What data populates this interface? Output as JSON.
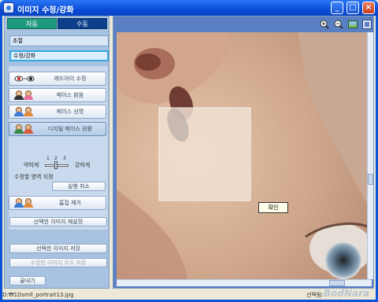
{
  "window": {
    "title": "이미지 수정/강화"
  },
  "tabs": [
    {
      "label": "자동"
    },
    {
      "label": "수동"
    }
  ],
  "sections": {
    "adjust": "조절",
    "correct": "수정/강화"
  },
  "tools": [
    {
      "label": "레드아이 수정",
      "icon": "red-eye-icon"
    },
    {
      "label": "페이스 밝음",
      "icon": "face-bright-icon"
    },
    {
      "label": "페이스 선명",
      "icon": "face-sharp-icon"
    },
    {
      "label": "디지털 페이스 원활",
      "icon": "digital-face-smooth-icon"
    }
  ],
  "slider": {
    "weak": "약하게",
    "strong": "강하게",
    "ticks": [
      "1",
      "2",
      "3"
    ],
    "level": 2
  },
  "area_label": "수정할 영역 지정",
  "undo_label": "실행 취소",
  "blemish_label": "흠집 제거",
  "reset_label": "선택한 이미지 재설정",
  "save_selected_label": "선택한 이미지 저장",
  "save_all_label": "수정한 이미지 모두 저장",
  "exit_label": "끝내기",
  "canvas": {
    "confirm_label": "확인",
    "toolbar_icons": [
      "zoom-in-icon",
      "zoom-out-icon",
      "image-icon",
      "view-icon"
    ]
  },
  "status": {
    "path": "D:₩1Dsmll_portrait13.jpg",
    "selection": "선택됨:",
    "watermark": "BodNara"
  }
}
